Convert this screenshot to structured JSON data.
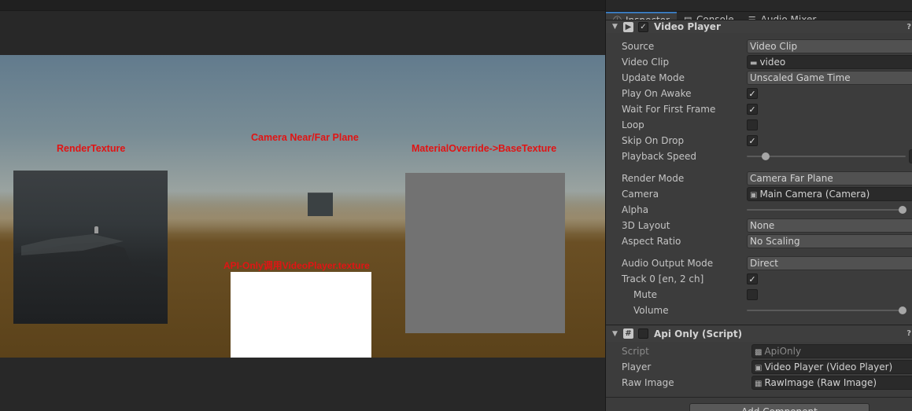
{
  "scene": {
    "label_render_texture": "RenderTexture",
    "label_camera_plane": "Camera Near/Far Plane",
    "label_material_override": "MaterialOverride->BaseTexture",
    "label_api_only": "API-Only调用VideoPlayer.texture"
  },
  "tabs": [
    {
      "label": "Inspector",
      "icon": "info-icon"
    },
    {
      "label": "Console",
      "icon": "console-icon"
    },
    {
      "label": "Audio Mixer",
      "icon": "mixer-icon"
    }
  ],
  "video_player": {
    "title": "Video Player",
    "enabled": true,
    "source_label": "Source",
    "source_value": "Video Clip",
    "clip_label": "Video Clip",
    "clip_value": "video",
    "update_label": "Update Mode",
    "update_value": "Unscaled Game Time",
    "awake_label": "Play On Awake",
    "awake": true,
    "wait_label": "Wait For First Frame",
    "wait": true,
    "loop_label": "Loop",
    "loop": false,
    "skip_label": "Skip On Drop",
    "skip": true,
    "speed_label": "Playback Speed",
    "speed_fraction": 0.12,
    "render_label": "Render Mode",
    "render_value": "Camera Far Plane",
    "camera_label": "Camera",
    "camera_value": "Main Camera (Camera)",
    "alpha_label": "Alpha",
    "alpha_fraction": 0.98,
    "layout_label": "3D Layout",
    "layout_value": "None",
    "aspect_label": "Aspect Ratio",
    "aspect_value": "No Scaling",
    "audio_label": "Audio Output Mode",
    "audio_value": "Direct",
    "track_label": "Track 0 [en, 2 ch]",
    "track": true,
    "mute_label": "Mute",
    "mute": false,
    "volume_label": "Volume",
    "volume_fraction": 0.98
  },
  "api_only": {
    "title": "Api Only (Script)",
    "enabled": false,
    "script_label": "Script",
    "script_value": "ApiOnly",
    "player_label": "Player",
    "player_value": "Video Player (Video Player)",
    "raw_label": "Raw Image",
    "raw_value": "RawImage (Raw Image)"
  },
  "add_component_label": "Add Component"
}
